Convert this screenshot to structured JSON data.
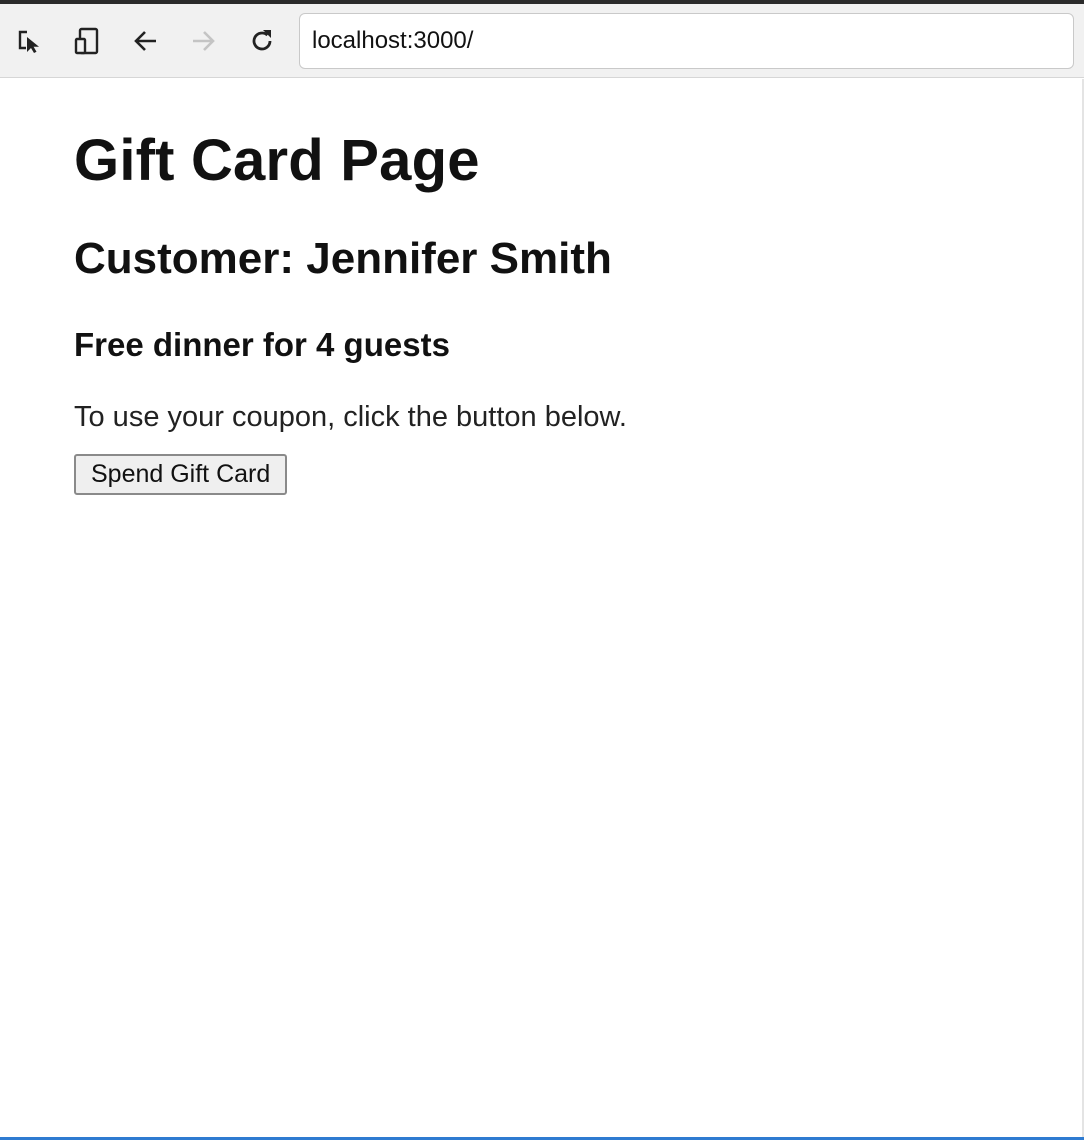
{
  "browser": {
    "url": "localhost:3000/",
    "icons": {
      "inspect": "inspect-element-icon",
      "device": "device-toolbar-icon",
      "back": "back-arrow-icon",
      "forward": "forward-arrow-icon",
      "reload": "reload-icon"
    },
    "colors": {
      "toolbar_bg": "#f1f1f1",
      "accent": "#2f7bd1"
    }
  },
  "page": {
    "title": "Gift Card Page",
    "customer": "Customer: Jennifer Smith",
    "offer": "Free dinner for 4 guests",
    "instruction": "To use your coupon, click the button below.",
    "button_label": "Spend Gift Card"
  }
}
